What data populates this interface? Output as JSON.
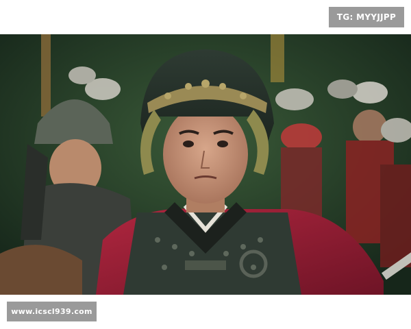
{
  "watermarks": {
    "top_right": "TG: MYYJJPP",
    "bottom_left": "www.icscl939.com"
  },
  "still": {
    "subject": "armored-general-portrait",
    "palette": {
      "background_foliage": "#2b4a30",
      "helmet_metal": "#3b4a3c",
      "helmet_gold": "#9a8a55",
      "cape_red": "#9c1f36",
      "armor_dark": "#2f3a33",
      "skin": "#c89478",
      "soldier_red": "#b23a3a"
    }
  }
}
